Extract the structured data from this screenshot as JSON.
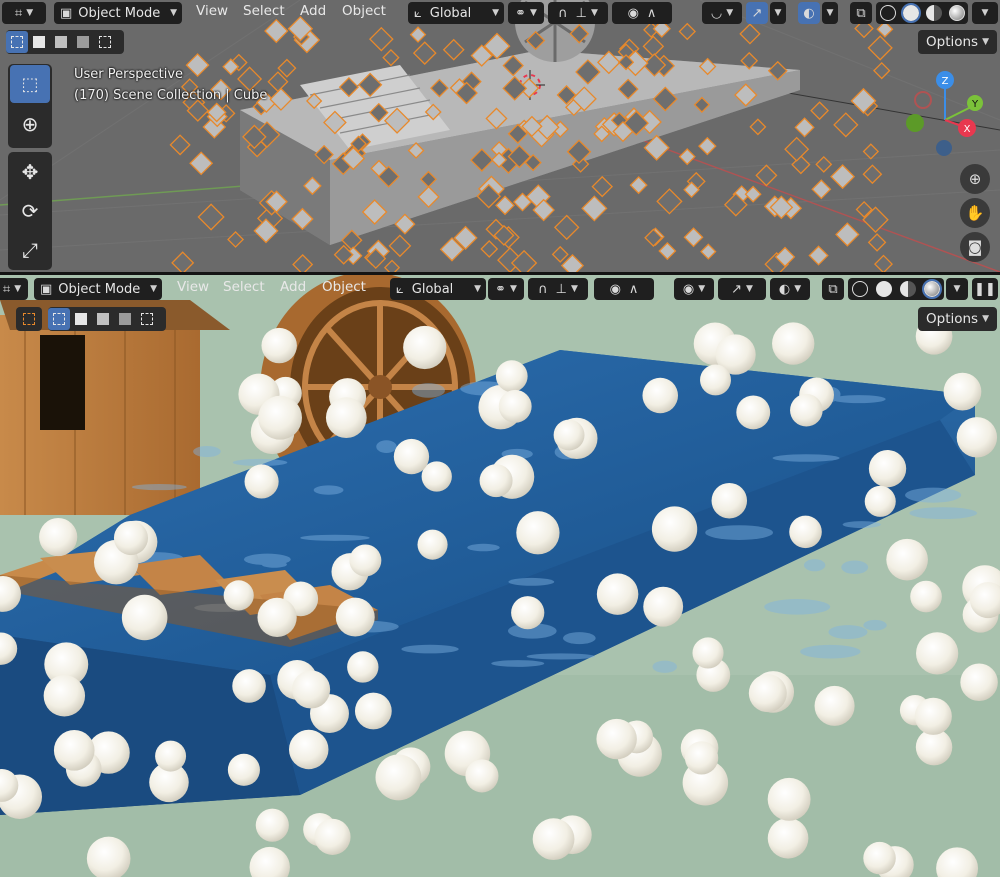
{
  "top_viewport": {
    "header": {
      "mode_label": "Object Mode",
      "menus": [
        "View",
        "Select",
        "Add",
        "Object"
      ],
      "transform_orientation": "Global"
    },
    "overlay": {
      "view_name": "User Perspective",
      "scene_info": "(170) Scene Collection | Cube"
    },
    "options_label": "Options",
    "tools": [
      "select-box",
      "cursor",
      "move",
      "rotate",
      "scale"
    ],
    "gizmo_axes": [
      "Z",
      "Y",
      "X"
    ]
  },
  "bottom_viewport": {
    "header": {
      "mode_label": "Object Mode",
      "menus": [
        "View",
        "Select",
        "Add",
        "Object"
      ],
      "transform_orientation": "Global"
    },
    "options_label": "Options"
  },
  "colors": {
    "accent": "#4772b3",
    "selection_outline": "#e8892b",
    "axis_x": "#e8384f",
    "axis_y": "#7bc23a",
    "axis_z": "#3b8ee8",
    "header_bg": "#2b2b2b",
    "water": "#1f5f9c",
    "floor": "#a9c2ae",
    "wood": "#b9793b"
  }
}
